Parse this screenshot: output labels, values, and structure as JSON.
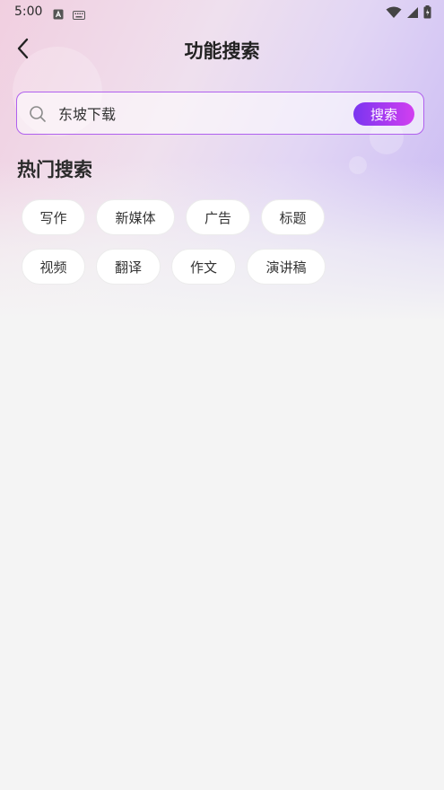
{
  "status_bar": {
    "time": "5:00",
    "icons_left": [
      "a-box-icon",
      "keyboard-icon"
    ],
    "icons_right": [
      "wifi-icon",
      "signal-icon",
      "battery-icon"
    ]
  },
  "header": {
    "back_icon": "chevron-left-icon",
    "title": "功能搜索"
  },
  "search": {
    "icon": "search-icon",
    "value": "东坡下载",
    "button_label": "搜索",
    "border_color": "#b060ee",
    "button_gradient": [
      "#7a35f0",
      "#d23ff0"
    ]
  },
  "hot_search": {
    "title": "热门搜索",
    "tags": [
      "写作",
      "新媒体",
      "广告",
      "标题",
      "视频",
      "翻译",
      "作文",
      "演讲稿"
    ]
  },
  "colors": {
    "page_bg": "#f4f4f4",
    "header_gradient": [
      "#f1cfe0",
      "#c6b6f3"
    ]
  }
}
